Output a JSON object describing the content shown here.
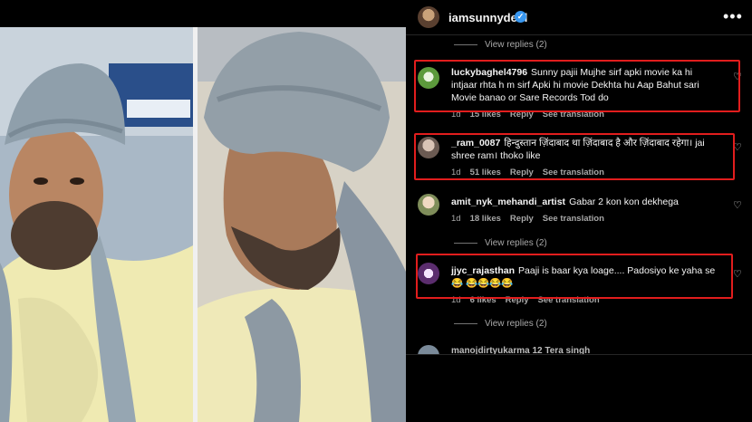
{
  "post": {
    "username": "iamsunnydeol",
    "verified_badge": "✓",
    "more_icon": "•••"
  },
  "top_view_replies": "View replies (2)",
  "comments": [
    {
      "username": "luckybaghel4796",
      "text": "Sunny pajii Mujhe sirf apki movie ka hi intjaar rhta h m sirf Apki hi movie Dekhta hu Aap Bahut sari Movie banao or Sare Records Tod do",
      "time": "1d",
      "likes": "15 likes",
      "reply": "Reply",
      "translate": "See translation"
    },
    {
      "username": "_ram_0087",
      "text": "हिन्दुस्तान ज़िंदाबाद था ज़िंदाबाद है और ज़िंदाबाद रहेगा। jai shree ram। thoko like",
      "time": "1d",
      "likes": "51 likes",
      "reply": "Reply",
      "translate": "See translation"
    },
    {
      "username": "amit_nyk_mehandi_artist",
      "text": "Gabar 2 kon kon dekhega",
      "time": "1d",
      "likes": "18 likes",
      "reply": "Reply",
      "translate": "See translation",
      "view_replies": "View replies (2)"
    },
    {
      "username": "jjyc_rajasthan",
      "text": "Paaji is baar kya loage.... Padosiyo ke yaha se😂 😂😂😂😂",
      "time": "1d",
      "likes": "6 likes",
      "reply": "Reply",
      "translate": "See translation",
      "view_replies": "View replies (2)"
    }
  ],
  "partial_comment": "manojdirtyukarma 12 Tera singh",
  "icons": {
    "heart": "♡"
  },
  "colors": {
    "highlight_box": "#e11d1d",
    "verified": "#3897f0"
  }
}
